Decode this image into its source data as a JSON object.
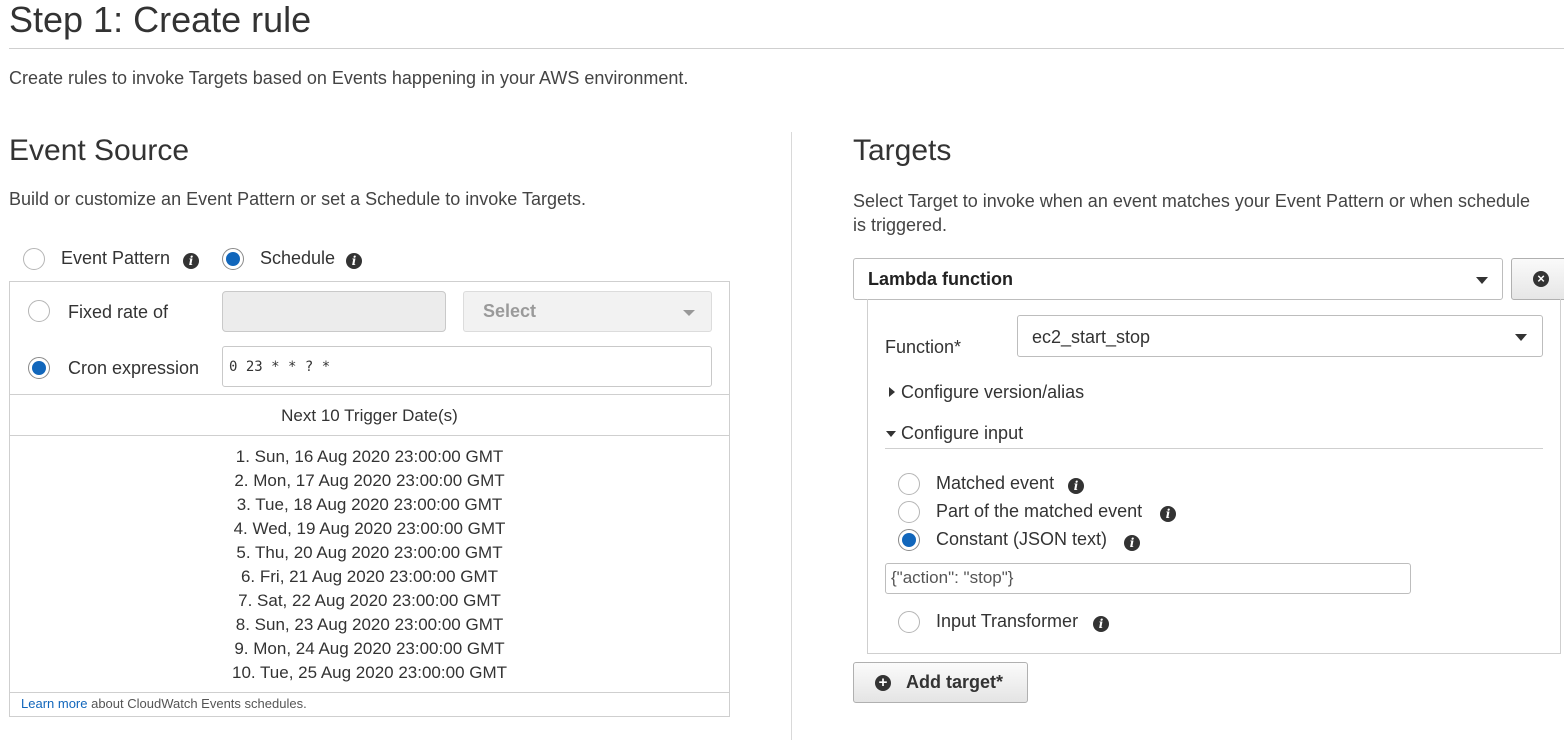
{
  "page": {
    "title": "Step 1: Create rule",
    "intro": "Create rules to invoke Targets based on Events happening in your AWS environment."
  },
  "event_source": {
    "heading": "Event Source",
    "description": "Build or customize an Event Pattern or set a Schedule to invoke Targets.",
    "mode_options": [
      {
        "label": "Event Pattern",
        "selected": false
      },
      {
        "label": "Schedule",
        "selected": true
      }
    ],
    "fixed_rate_label": "Fixed rate of",
    "fixed_rate_value": "",
    "unit_select": "Select",
    "cron_label": "Cron expression",
    "cron_value": "0 23 * * ? *",
    "schedule_type": "cron",
    "next_dates_header": "Next 10 Trigger Date(s)",
    "next_dates": [
      "1. Sun, 16 Aug 2020 23:00:00 GMT",
      "2. Mon, 17 Aug 2020 23:00:00 GMT",
      "3. Tue, 18 Aug 2020 23:00:00 GMT",
      "4. Wed, 19 Aug 2020 23:00:00 GMT",
      "5. Thu, 20 Aug 2020 23:00:00 GMT",
      "6. Fri, 21 Aug 2020 23:00:00 GMT",
      "7. Sat, 22 Aug 2020 23:00:00 GMT",
      "8. Sun, 23 Aug 2020 23:00:00 GMT",
      "9. Mon, 24 Aug 2020 23:00:00 GMT",
      "10. Tue, 25 Aug 2020 23:00:00 GMT"
    ],
    "learn_more_link": "Learn more",
    "learn_more_rest": " about CloudWatch Events schedules."
  },
  "targets": {
    "heading": "Targets",
    "description_line1": "Select Target to invoke when an event matches your Event Pattern or when schedule",
    "description_line2": "is triggered.",
    "target_type": "Lambda function",
    "function_label": "Function*",
    "function_value": "ec2_start_stop",
    "configure_version": "Configure version/alias",
    "configure_input": "Configure input",
    "input_options": [
      {
        "label": "Matched event",
        "selected": false
      },
      {
        "label": "Part of the matched event",
        "selected": false
      },
      {
        "label": "Constant (JSON text)",
        "selected": true
      },
      {
        "label": "Input Transformer",
        "selected": false
      }
    ],
    "json_value": "{\"action\": \"stop\"}",
    "add_target_label": "Add target*"
  },
  "icons": {
    "info": "info-icon",
    "remove": "remove-circle-icon",
    "add": "plus-circle-icon"
  },
  "colors": {
    "accent": "#1166bb",
    "text": "#333333",
    "border": "#cfcfcf"
  }
}
